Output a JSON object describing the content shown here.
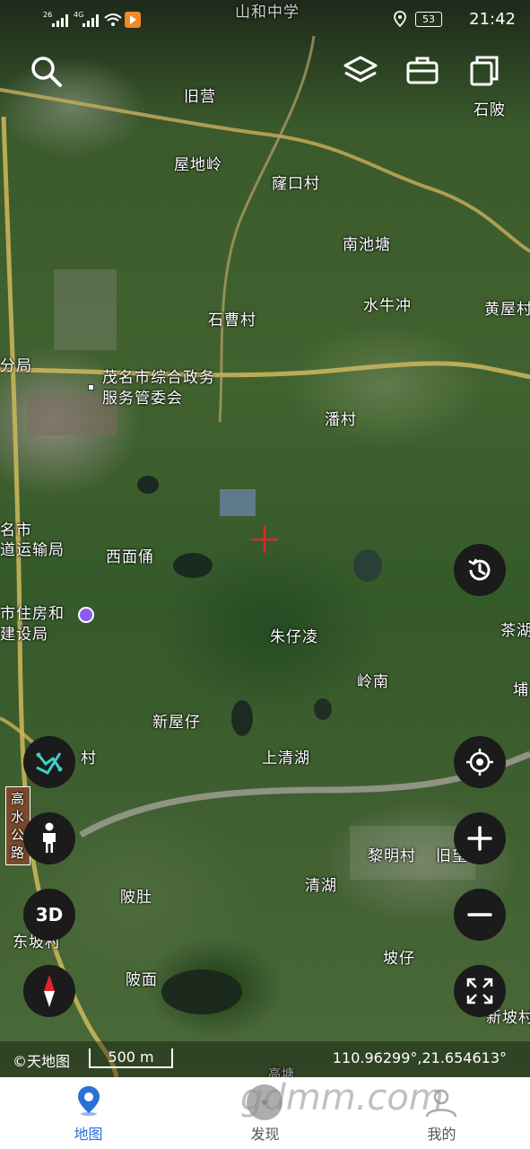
{
  "status_bar": {
    "signal1": "26",
    "signal2": "4G",
    "battery": "53",
    "time": "21:42",
    "icons": [
      "signal-icon",
      "wifi-icon",
      "app-notification-icon",
      "location-icon",
      "battery-icon"
    ]
  },
  "top_buttons": [
    "search-icon",
    "layers-icon",
    "toolbox-icon",
    "copy-icon"
  ],
  "map": {
    "places": [
      "山和中学",
      "旧营",
      "石陂",
      "屋地岭",
      "窿口村",
      "南池塘",
      "水牛冲",
      "黄屋村",
      "石曹村",
      "分局",
      "茂名市综合政务",
      "服务管委会",
      "潘村",
      "名市",
      "道运输局",
      "西面俑",
      "市住房和",
      "建设局",
      "朱仔凌",
      "茶湖",
      "岭南",
      "埔",
      "新屋仔",
      "村",
      "上清湖",
      "高水公路",
      "黎明村",
      "旧望",
      "陂肚",
      "清湖",
      "东坡村",
      "坡仔",
      "陂面",
      "新坡村",
      "高塘"
    ]
  },
  "right_buttons": [
    "history-icon",
    "locate-icon",
    "zoom-in-icon",
    "zoom-out-icon",
    "fullscreen-icon"
  ],
  "left_buttons": {
    "route_icon": "route-icon",
    "walk_icon": "pedestrian-icon",
    "three_d_label": "3D",
    "compass_icon": "compass-icon"
  },
  "info": {
    "copyright": "©天地图",
    "scale": "500 m",
    "coordinates": "110.96299°,21.654613°"
  },
  "nav": {
    "items": [
      {
        "label": "地图",
        "icon": "map-pin-icon",
        "active": true
      },
      {
        "label": "发现",
        "icon": "discover-icon",
        "active": false
      },
      {
        "label": "我的",
        "icon": "profile-icon",
        "active": false
      }
    ]
  },
  "watermark": "gdmm.com",
  "colors": {
    "nav_active": "#2b6fd8",
    "route_icon": "#3fd0c7",
    "crosshair": "#e0262b",
    "location_dot": "#8a5cf0"
  }
}
